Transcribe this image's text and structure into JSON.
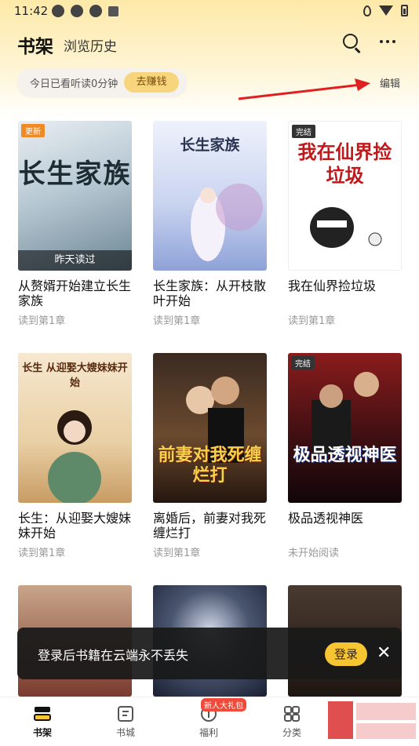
{
  "status_bar": {
    "time": "11:42"
  },
  "header": {
    "tab_shelf": "书架",
    "tab_history": "浏览历史"
  },
  "reading_bar": {
    "text": "今日已看听读0分钟",
    "earn_button": "去赚钱"
  },
  "edit_label": "编辑",
  "books": [
    {
      "title": "从赘婿开始建立长生家族",
      "progress": "读到第1章",
      "badge": "更新",
      "badge_type": "new",
      "strip": "昨天读过",
      "cover_text": "长生家族"
    },
    {
      "title": "长生家族：从开枝散叶开始",
      "progress": "读到第1章",
      "badge": "",
      "badge_type": "",
      "strip": "",
      "cover_text": "长生家族"
    },
    {
      "title": "我在仙界捡垃圾",
      "progress": "读到第1章",
      "badge": "完结",
      "badge_type": "done",
      "strip": "",
      "cover_text": "我在仙界捡垃圾"
    },
    {
      "title": "长生：从迎娶大嫂妹妹开始",
      "progress": "读到第1章",
      "badge": "",
      "badge_type": "",
      "strip": "",
      "cover_text": "长生 从迎娶大嫂妹妹开始"
    },
    {
      "title": "离婚后，前妻对我死缠烂打",
      "progress": "读到第1章",
      "badge": "",
      "badge_type": "",
      "strip": "",
      "cover_text": "前妻对我死缠烂打"
    },
    {
      "title": "极品透视神医",
      "progress": "未开始阅读",
      "badge": "完结",
      "badge_type": "done",
      "strip": "",
      "cover_text": "极品透视神医"
    },
    {
      "title": "",
      "progress": "",
      "badge": "",
      "badge_type": "",
      "strip": "",
      "cover_text": ""
    },
    {
      "title": "",
      "progress": "",
      "badge": "",
      "badge_type": "",
      "strip": "",
      "cover_text": ""
    },
    {
      "title": "",
      "progress": "",
      "badge": "",
      "badge_type": "",
      "strip": "",
      "cover_text": ""
    }
  ],
  "toast": {
    "text": "登录后书籍在云端永不丢失",
    "login_button": "登录",
    "close": "✕"
  },
  "bottom_nav": [
    {
      "label": "书架",
      "icon": "bookshelf-icon"
    },
    {
      "label": "书城",
      "icon": "bookstore-icon"
    },
    {
      "label": "福利",
      "icon": "welfare-icon"
    },
    {
      "label": "分类",
      "icon": "category-icon"
    }
  ],
  "gift_badge": "新人大礼包",
  "colors": {
    "accent": "#f7c531",
    "header_bg": "#fde9a8",
    "arrow": "#e02020"
  }
}
